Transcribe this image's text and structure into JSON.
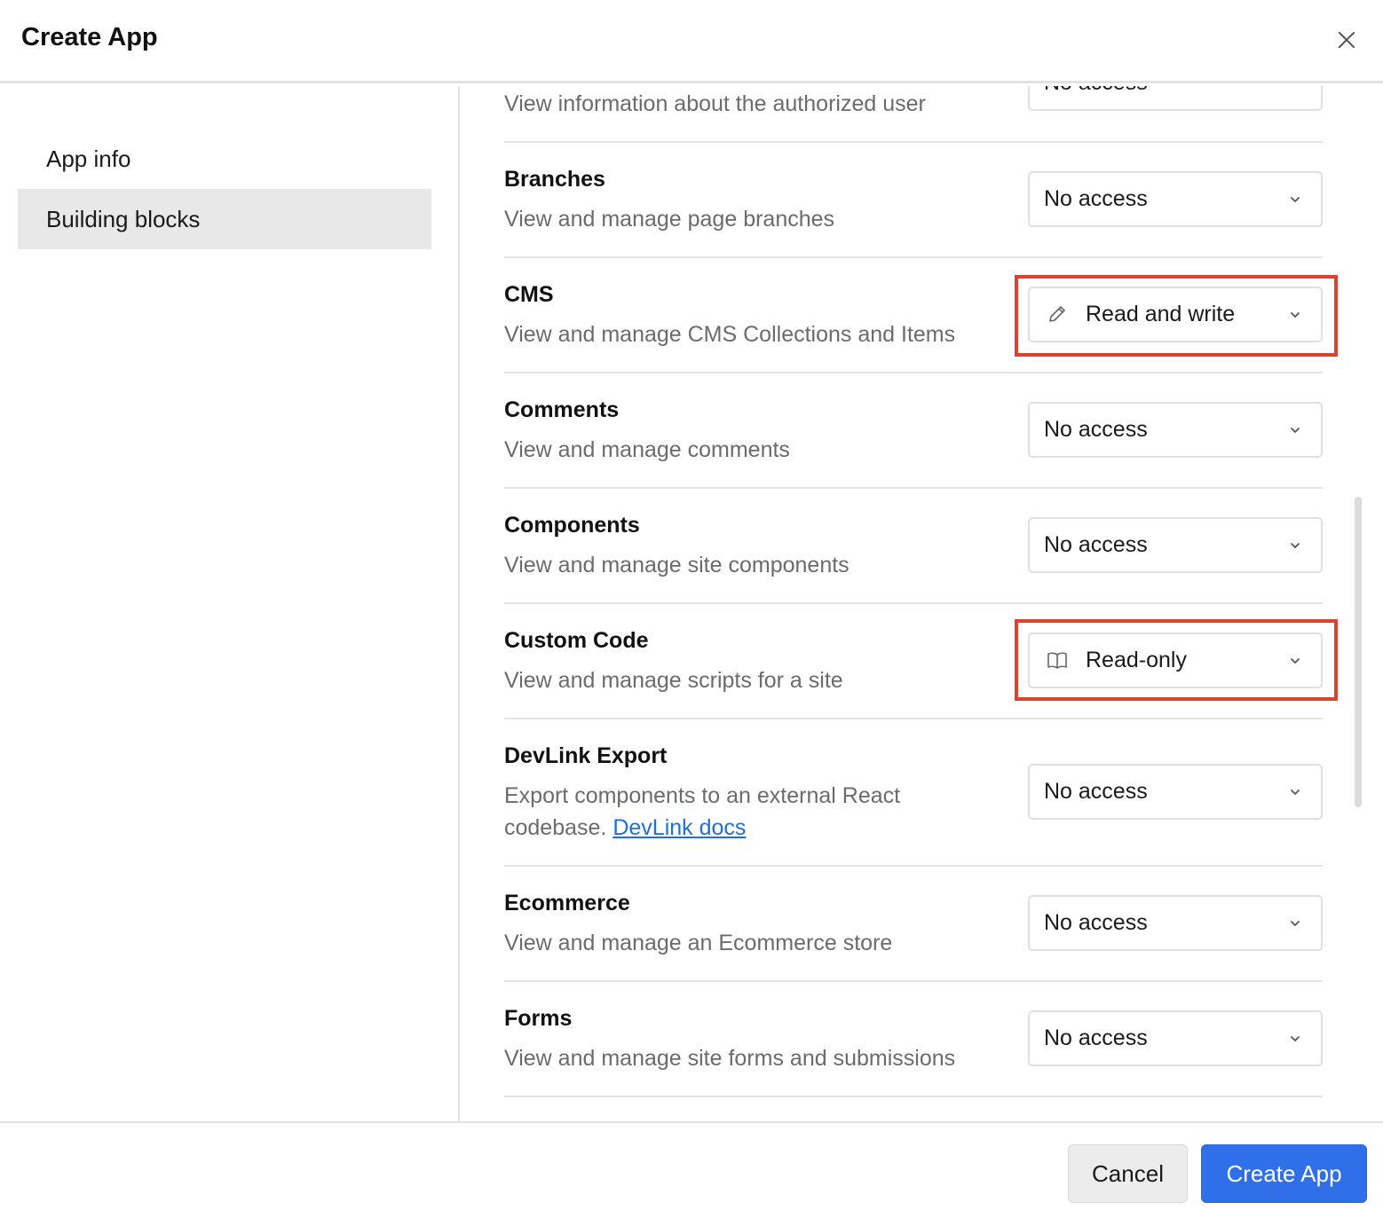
{
  "dialog": {
    "title": "Create App"
  },
  "sidebar": {
    "items": [
      {
        "label": "App info",
        "active": false
      },
      {
        "label": "Building blocks",
        "active": true
      }
    ]
  },
  "permissions": [
    {
      "title": "",
      "description": "View information about the authorized user",
      "value": "No access",
      "icon": ""
    },
    {
      "title": "Branches",
      "description": "View and manage page branches",
      "value": "No access",
      "icon": ""
    },
    {
      "title": "CMS",
      "description": "View and manage CMS Collections and Items",
      "value": "Read and write",
      "icon": "pencil-icon",
      "highlighted": true
    },
    {
      "title": "Comments",
      "description": "View and manage comments",
      "value": "No access",
      "icon": ""
    },
    {
      "title": "Components",
      "description": "View and manage site components",
      "value": "No access",
      "icon": ""
    },
    {
      "title": "Custom Code",
      "description": "View and manage scripts for a site",
      "value": "Read-only",
      "icon": "book-icon",
      "highlighted": true
    },
    {
      "title": "DevLink Export",
      "description": "Export components to an external React",
      "description_line2": "codebase.",
      "link": "DevLink docs",
      "value": "No access",
      "icon": ""
    },
    {
      "title": "Ecommerce",
      "description": "View and manage an Ecommerce store",
      "value": "No access",
      "icon": ""
    },
    {
      "title": "Forms",
      "description": "View and manage site forms and submissions",
      "value": "No access",
      "icon": ""
    }
  ],
  "footer": {
    "cancel_label": "Cancel",
    "create_label": "Create App"
  },
  "colors": {
    "primary": "#2f6fe8",
    "highlight": "#d9432f",
    "link": "#1f6fd8"
  }
}
